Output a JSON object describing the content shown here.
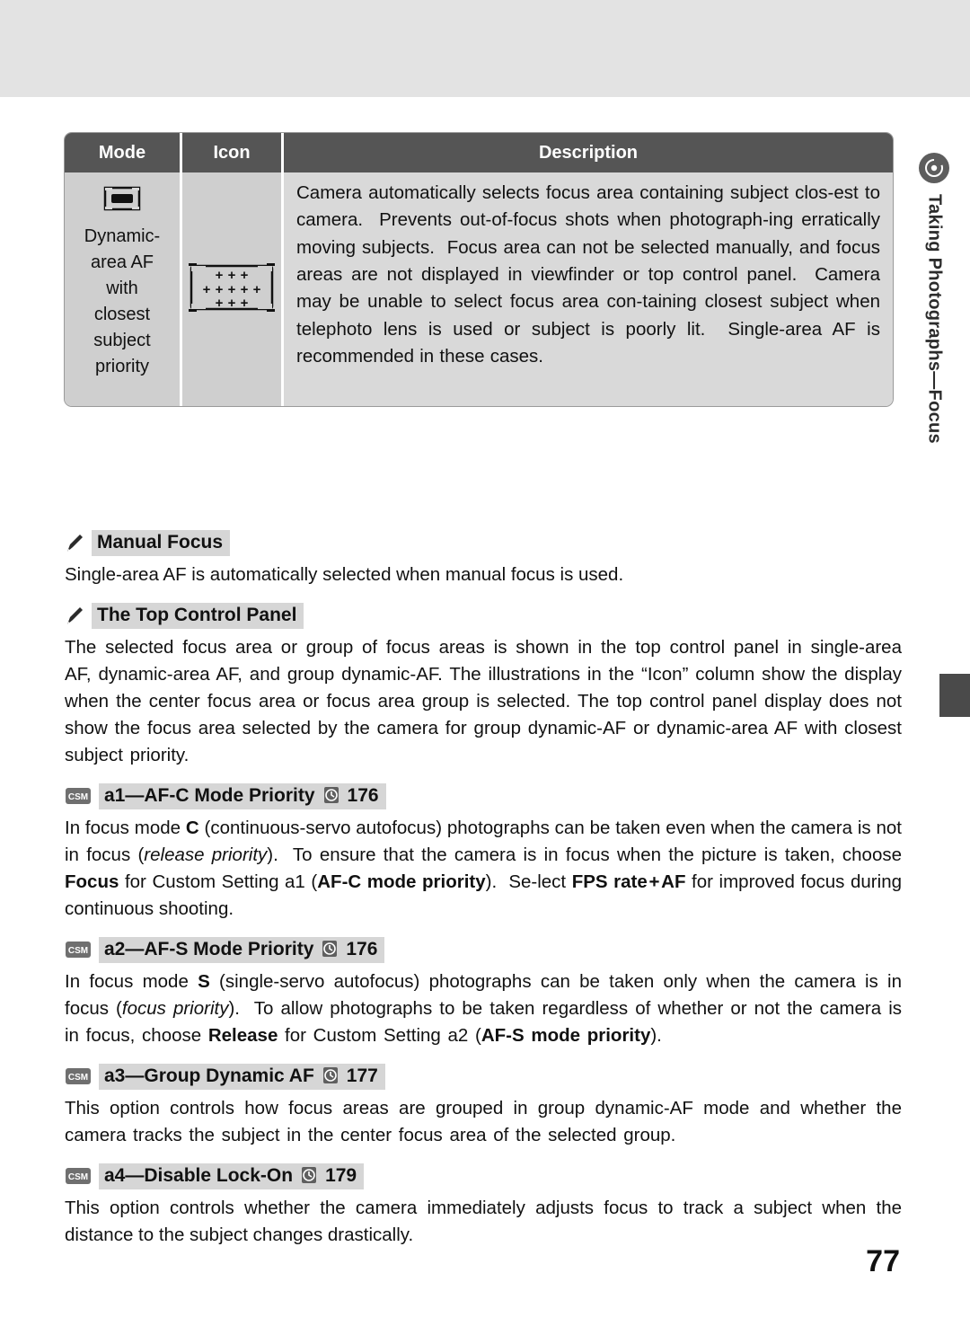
{
  "running_head": {
    "text": "Taking Photographs—Focus",
    "icon": "camera-focus-icon"
  },
  "table": {
    "headers": {
      "mode": "Mode",
      "icon": "Icon",
      "description": "Description"
    },
    "rows": [
      {
        "mode": "Dynamic-\narea AF\nwith\nclosest\nsubject\npriority",
        "mode_icon": "af-area-bracket-icon",
        "icon_cell": "focus-area-grid-icon",
        "description": "Camera automatically selects focus area containing subject clos-est to camera.  Prevents out-of-focus shots when photograph-ing erratically moving subjects.  Focus area can not be selected manually, and focus areas are not displayed in viewfinder or top control panel.  Camera may be unable to select focus area con-taining closest subject when telephoto lens is used or subject is poorly lit.  Single-area AF is recommended in these cases."
      }
    ]
  },
  "sections": [
    {
      "id": "manual-focus",
      "icon": "pencil-icon",
      "title": "Manual Focus",
      "page_ref": "",
      "paragraphs": [
        "Single-area AF is automatically selected when manual focus is used."
      ]
    },
    {
      "id": "top-control-panel",
      "icon": "pencil-icon",
      "title": "The Top Control Panel",
      "page_ref": "",
      "paragraphs": [
        "The selected focus area or group of focus areas is shown in the top control panel in single-area AF, dynamic-area AF, and group dynamic-AF.  The illustrations in the “Icon” column show the display when the center focus area or focus area group is selected.  The top control panel display does not show the focus area selected by the camera for group dynamic-AF or dynamic-area AF with closest subject priority."
      ]
    },
    {
      "id": "a1-af-c-mode-priority",
      "icon": "csm-icon",
      "title": "a1—AF-C Mode Priority",
      "page_ref": "176",
      "paragraphs": [
        "In focus mode C (continuous-servo autofocus) photographs can be taken even when the camera is not in focus (release priority).  To ensure that the camera is in focus when the picture is taken, choose Focus for Custom Setting a1 (AF-C mode priority).  Se-lect FPS rate + AF for improved focus during continuous shooting."
      ]
    },
    {
      "id": "a2-af-s-mode-priority",
      "icon": "csm-icon",
      "title": "a2—AF-S Mode Priority",
      "page_ref": "176",
      "paragraphs": [
        "In focus mode S (single-servo autofocus) photographs can be taken only when the camera is in focus (focus priority).  To allow photographs to be taken regardless of whether or not the camera is in focus, choose Release for Custom Setting a2 (AF-S mode priority)."
      ]
    },
    {
      "id": "a3-group-dynamic-af",
      "icon": "csm-icon",
      "title": "a3—Group Dynamic AF",
      "page_ref": "177",
      "paragraphs": [
        "This option controls how focus areas are grouped in group dynamic-AF mode and whether the camera tracks the subject in the center focus area of the selected group."
      ]
    },
    {
      "id": "a4-disable-lock-on",
      "icon": "csm-icon",
      "title": "a4—Disable Lock-On",
      "page_ref": "179",
      "paragraphs": [
        "This option controls whether the camera immediately adjusts focus to track a subject when the distance to the subject changes drastically."
      ]
    }
  ],
  "page_number": "77",
  "colors": {
    "header_bar": "#555555",
    "table_body": "#d4d4d4",
    "highlight": "#d6d6d6",
    "top_band": "#e3e3e3",
    "tab": "#4a4a4a"
  }
}
